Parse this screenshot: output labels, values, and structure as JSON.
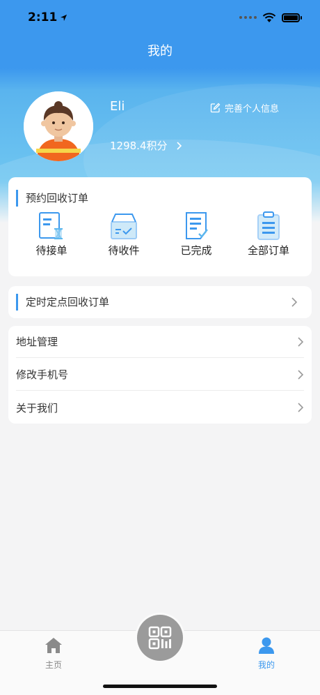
{
  "status_bar": {
    "time": "2:11"
  },
  "nav": {
    "title": "我的"
  },
  "profile": {
    "name": "Eli",
    "points": "1298.4积分",
    "edit_label": "完善个人信息"
  },
  "orders": {
    "title": "预约回收订单",
    "items": [
      {
        "label": "待接单",
        "icon": "pending-order-icon"
      },
      {
        "label": "待收件",
        "icon": "awaiting-pickup-icon"
      },
      {
        "label": "已完成",
        "icon": "completed-icon"
      },
      {
        "label": "全部订单",
        "icon": "all-orders-icon"
      }
    ]
  },
  "timed_orders": {
    "title": "定时定点回收订单"
  },
  "menu": [
    {
      "label": "地址管理"
    },
    {
      "label": "修改手机号"
    },
    {
      "label": "关于我们"
    }
  ],
  "tabbar": {
    "home": "主页",
    "mine": "我的",
    "active": "mine"
  },
  "colors": {
    "accent": "#3c98ee",
    "page_bg": "#f4f4f5"
  }
}
